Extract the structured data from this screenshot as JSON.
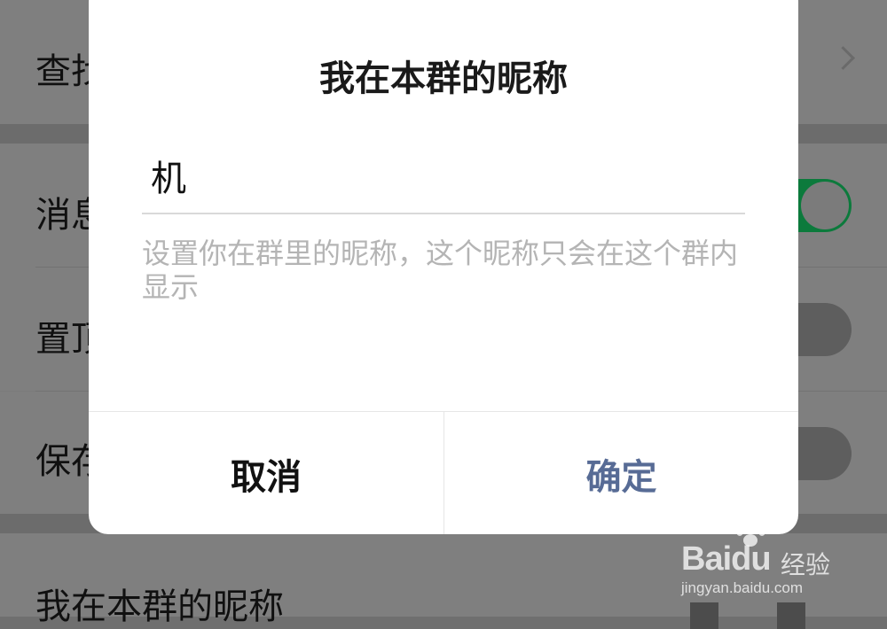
{
  "background": {
    "rows": [
      {
        "label": "查找"
      },
      {
        "label": "消息免打扰",
        "toggle": "on"
      },
      {
        "label": "置顶聊天",
        "toggle": "off"
      },
      {
        "label": "保存到通讯录",
        "toggle": "off"
      },
      {
        "label": "我在本群的昵称"
      }
    ]
  },
  "dialog": {
    "title": "我在本群的昵称",
    "input_value": "机",
    "hint": "设置你在群里的昵称，这个昵称只会在这个群内显示",
    "cancel_label": "取消",
    "confirm_label": "确定"
  },
  "watermark": {
    "logo": "Baidu",
    "tag": "经验",
    "url": "jingyan.baidu.com"
  },
  "colors": {
    "overlay": "#7b7b7b",
    "dialog_bg": "#ffffff",
    "confirm": "#576b95",
    "hint": "#b4b4b4",
    "toggle_on": "#0c7a3c"
  }
}
